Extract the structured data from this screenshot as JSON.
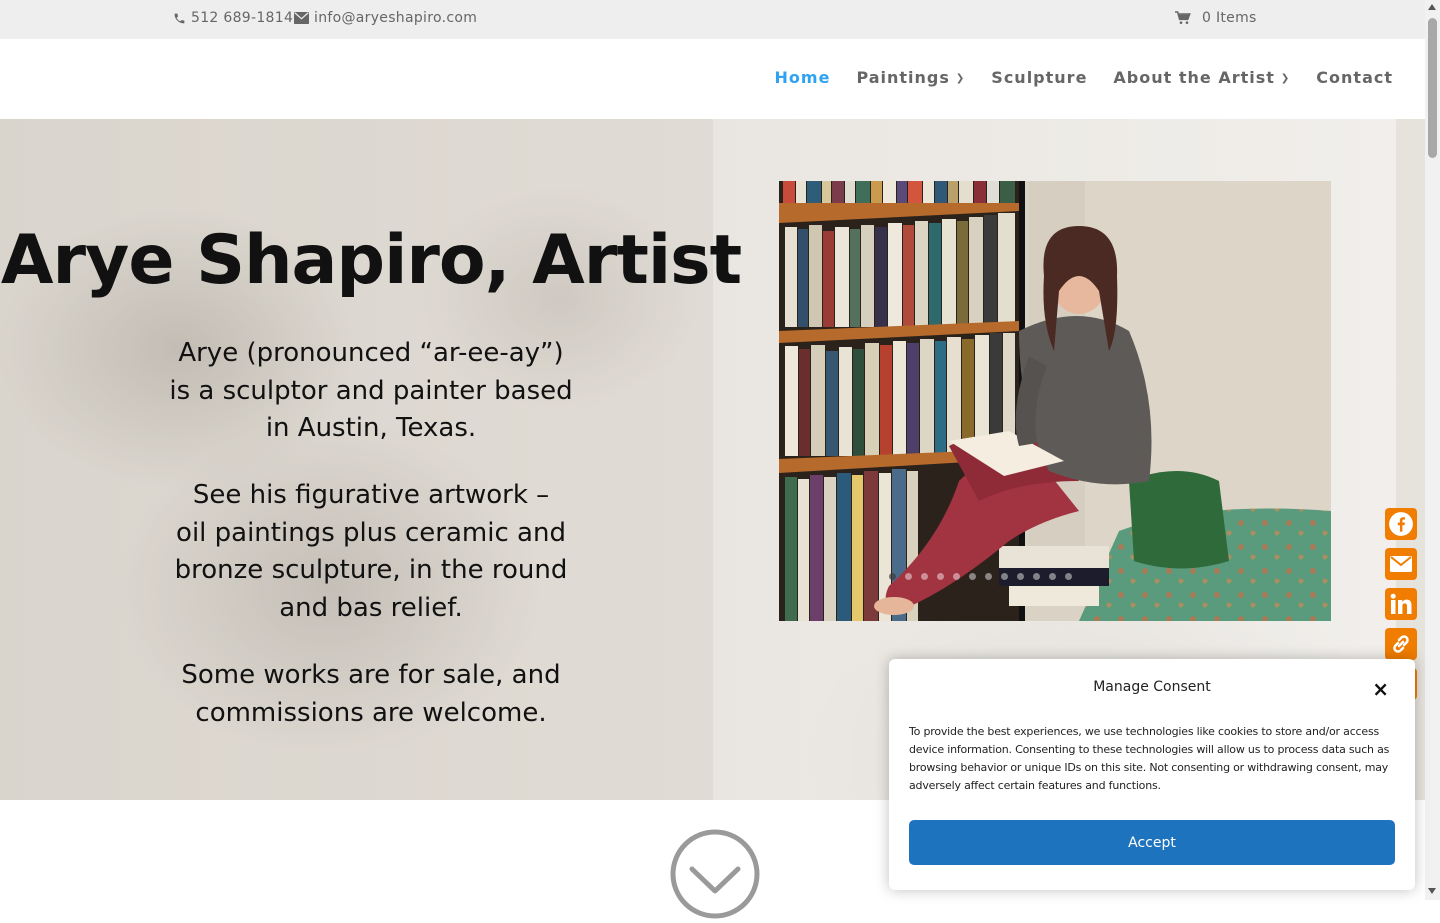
{
  "topbar": {
    "phone": "512 689-1814",
    "email": "info@aryeshapiro.com",
    "cart": "0 Items"
  },
  "nav": {
    "items": [
      {
        "label": "Home",
        "active": true
      },
      {
        "label": "Paintings",
        "has_dropdown": true
      },
      {
        "label": "Sculpture"
      },
      {
        "label": "About the Artist",
        "has_dropdown": true
      },
      {
        "label": "Contact"
      }
    ]
  },
  "hero": {
    "title": "Arye Shapiro, Artist",
    "p1": [
      "Arye (pronounced “ar-ee-ay”)",
      "is a sculptor and painter based",
      "in Austin, Texas."
    ],
    "p2": [
      "See his figurative artwork –",
      "oil paintings plus ceramic and",
      "bronze sculpture, in the round",
      "and bas relief."
    ],
    "p3": [
      "Some works are for sale, and",
      "commissions are welcome."
    ]
  },
  "slider": {
    "dot_count": 12,
    "active_index": 0
  },
  "share": {
    "buttons": [
      "facebook-icon",
      "email-icon",
      "linkedin-icon",
      "copy-link-icon",
      "share-plus-icon"
    ]
  },
  "consent": {
    "title": "Manage Consent",
    "close_glyph": "×",
    "text": "To provide the best experiences, we use technologies like cookies to store and/or access device information. Consenting to these technologies will allow us to process data such as browsing behavior or unique IDs on this site. Not consenting or withdrawing consent, may adversely affect certain features and functions.",
    "accept_label": "Accept"
  },
  "colors": {
    "accent": "#2ea3f2",
    "share_orange": "#f07d00",
    "accept_blue": "#1e73be"
  }
}
